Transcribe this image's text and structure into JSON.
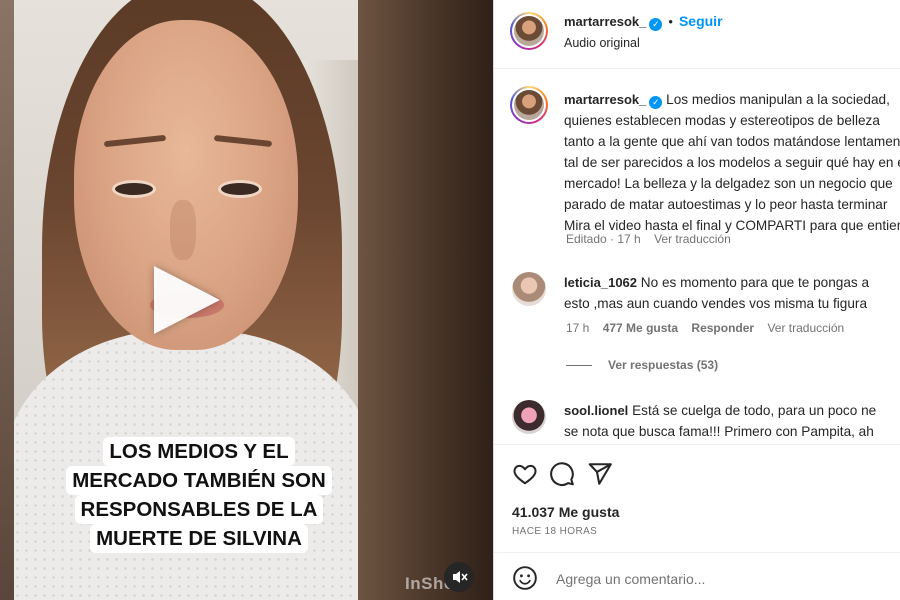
{
  "video": {
    "caption_lines": [
      "LOS MEDIOS Y EL",
      "MERCADO TAMBIÉN SON",
      "RESPONSABLES DE LA",
      "MUERTE DE SILVINA"
    ],
    "watermark": "InShot",
    "play_icon": "play-icon",
    "mute_icon": "muted-speaker-icon"
  },
  "post": {
    "username": "martarresok_",
    "follow_label": "Seguir",
    "audio_label": "Audio original",
    "caption_lines": [
      "Los medios manipulan a la sociedad,",
      "quienes establecen modas y estereotipos de belleza",
      "tanto a la gente que ahí van todos matándose lentamente",
      "tal de ser parecidos a los modelos a seguir qué hay en el",
      "mercado! La belleza y la delgadez son un negocio que",
      "parado de matar autoestimas y lo peor hasta terminar",
      "Mira el video hasta el final y COMPARTI para que entiendan"
    ],
    "edited": "Editado · 17 h",
    "translate": "Ver traducción",
    "likes": "41.037 Me gusta",
    "time_ago": "HACE 18 HORAS",
    "comment_placeholder": "Agrega un comentario..."
  },
  "comments": [
    {
      "username": "leticia_1062",
      "text_lines": [
        "No es momento para que te pongas a",
        "esto ,mas aun cuando vendes vos misma tu figura"
      ],
      "time": "17 h",
      "likes": "477 Me gusta",
      "reply": "Responder",
      "translate": "Ver traducción",
      "view_replies": "Ver respuestas (53)"
    },
    {
      "username": "sool.lionel",
      "text_lines": [
        "Está se cuelga de todo, para un poco ne",
        "se nota que busca fama!!! Primero con Pampita, ah"
      ]
    }
  ],
  "colors": {
    "link": "#0095f6",
    "text": "#262626",
    "muted": "#737373",
    "divider": "#efefef"
  }
}
